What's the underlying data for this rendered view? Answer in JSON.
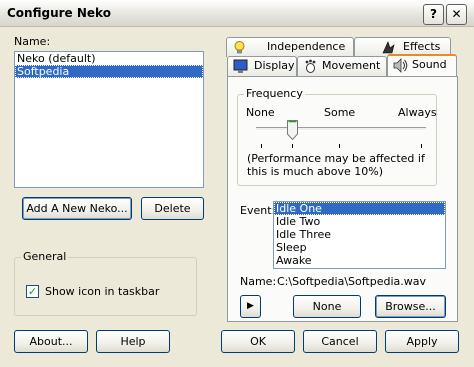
{
  "window": {
    "title": "Configure Neko",
    "help_glyph": "?",
    "close_glyph": "✕"
  },
  "left": {
    "name_label": "Name:",
    "neko_list": [
      "Neko (default)",
      "Softpedia"
    ],
    "selected_index": 1,
    "add_button": "Add A New Neko...",
    "delete_button": "Delete",
    "general_title": "General",
    "show_icon_label": "Show icon in taskbar",
    "show_icon_checked": true
  },
  "tabs": {
    "row_back": [
      {
        "label": "Independence",
        "icon": "lightbulb-icon"
      },
      {
        "label": "Effects",
        "icon": "effects-icon"
      }
    ],
    "row_front": [
      {
        "label": "Display",
        "icon": "monitor-icon"
      },
      {
        "label": "Movement",
        "icon": "footprint-icon"
      },
      {
        "label": "Sound",
        "icon": "speaker-icon"
      }
    ],
    "active": "Sound"
  },
  "sound": {
    "frequency_title": "Frequency",
    "slider_labels": [
      "None",
      "Some",
      "Always"
    ],
    "note": "(Performance may be affected if this is much above 10%)",
    "event_label": "Event:",
    "events": [
      "Idle One",
      "Idle Two",
      "Idle Three",
      "Sleep",
      "Awake"
    ],
    "selected_event": 0,
    "name_label": "Name:",
    "name_value": "C:\\Softpedia\\Softpedia.wav",
    "play_glyph": "▶",
    "none_button": "None",
    "browse_button": "Browse..."
  },
  "footer": {
    "about": "About...",
    "help": "Help",
    "ok": "OK",
    "cancel": "Cancel",
    "apply": "Apply"
  },
  "colors": {
    "selection": "#316ac5",
    "tab_highlight": "#e68b2c",
    "face": "#ece9d8"
  }
}
